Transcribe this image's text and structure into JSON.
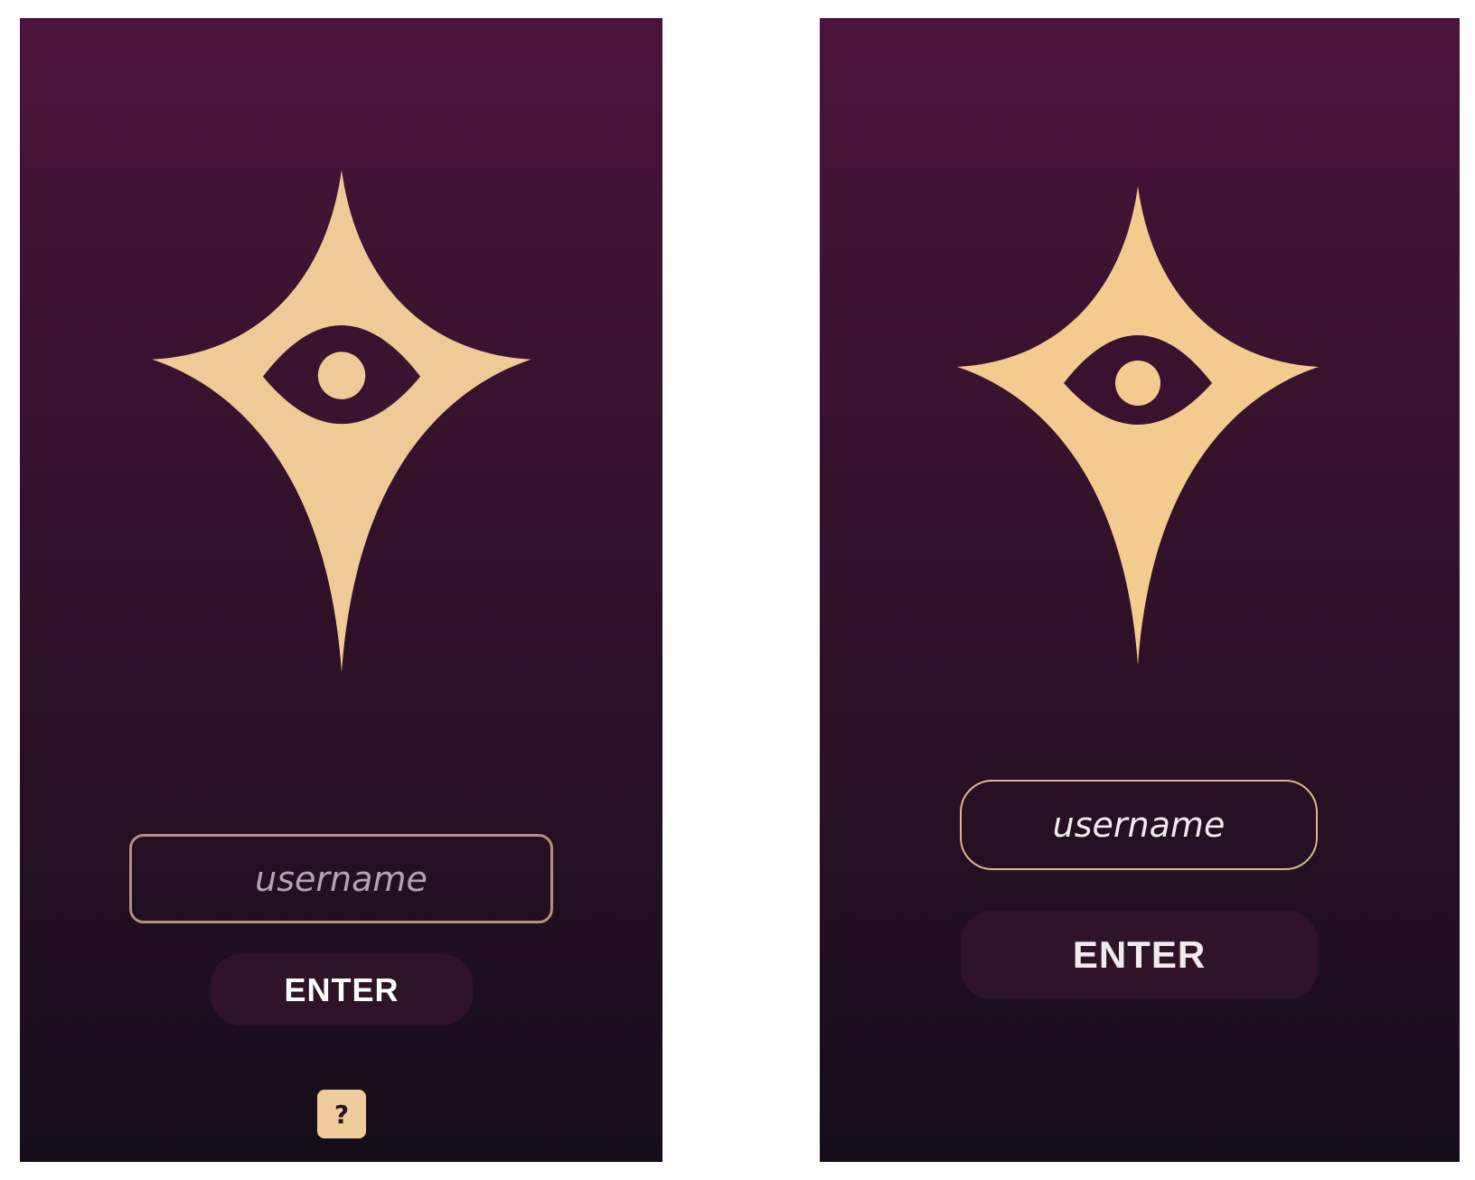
{
  "screens": [
    {
      "variant": "left",
      "username_placeholder": "username",
      "enter_label": "ENTER",
      "help_label": "?",
      "colors": {
        "logo": "#efca96",
        "field_border": "#b0917e",
        "button_bg": "#2f1429"
      }
    },
    {
      "variant": "right",
      "username_placeholder": "username",
      "enter_label": "ENTER",
      "colors": {
        "logo": "#f4cb8f",
        "field_border": "#d6b98f",
        "button_bg": "#2f1429"
      }
    }
  ],
  "icons": {
    "logo": "star-eye-icon",
    "help": "question-mark"
  }
}
